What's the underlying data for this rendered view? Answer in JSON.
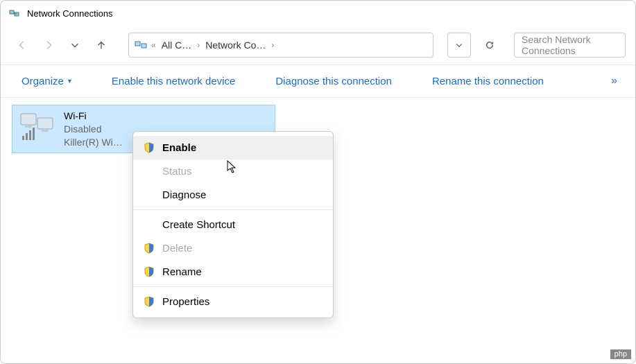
{
  "window": {
    "title": "Network Connections"
  },
  "nav": {
    "breadcrumb": {
      "part1": "All C…",
      "part2": "Network Co…"
    },
    "search_placeholder": "Search Network Connections"
  },
  "cmdbar": {
    "organize": "Organize",
    "enable": "Enable this network device",
    "diagnose": "Diagnose this connection",
    "rename": "Rename this connection"
  },
  "adapter": {
    "name": "Wi-Fi",
    "status": "Disabled",
    "device": "Killer(R) Wi…"
  },
  "context_menu": {
    "enable": "Enable",
    "status": "Status",
    "diagnose": "Diagnose",
    "create_shortcut": "Create Shortcut",
    "delete": "Delete",
    "rename": "Rename",
    "properties": "Properties"
  },
  "watermark": "php"
}
